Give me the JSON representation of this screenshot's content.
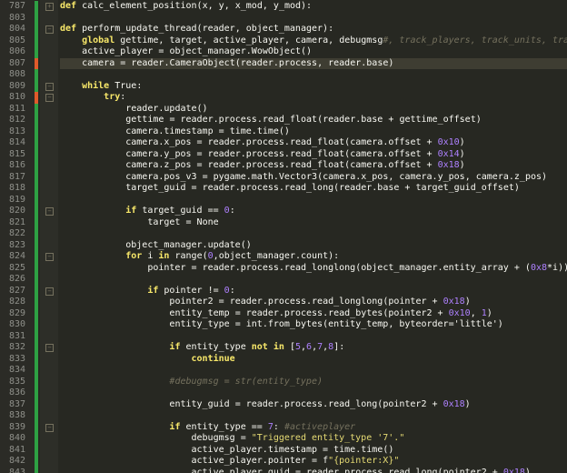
{
  "colors": {
    "background": "#272822",
    "diff_added": "#2ea043",
    "diff_modified": "#e05a2b",
    "keyword": "#f8e86a",
    "number": "#ae81ff",
    "string": "#e6db74",
    "comment": "#75715e"
  },
  "lines": [
    {
      "n": "787",
      "text": "def calc_element_position(x, y, x_mod, y_mod):",
      "fold": true
    },
    {
      "n": "803",
      "text": ""
    },
    {
      "n": "804",
      "text": "def perform_update_thread(reader, object_manager):",
      "fold": true
    },
    {
      "n": "805",
      "text": "    global gettime, target, active_player, camera, debugmsg#, track_players, track_units, track_o"
    },
    {
      "n": "806",
      "text": "    active_player = object_manager.WowObject()"
    },
    {
      "n": "807",
      "text": "    camera = reader.CameraObject(reader.process, reader.base)",
      "current": true
    },
    {
      "n": "808",
      "text": ""
    },
    {
      "n": "809",
      "text": "    while True:",
      "fold": true
    },
    {
      "n": "810",
      "text": "        try:",
      "fold": true
    },
    {
      "n": "811",
      "text": "            reader.update()"
    },
    {
      "n": "812",
      "text": "            gettime = reader.process.read_float(reader.base + gettime_offset)"
    },
    {
      "n": "813",
      "text": "            camera.timestamp = time.time()"
    },
    {
      "n": "814",
      "text": "            camera.x_pos = reader.process.read_float(camera.offset + 0x10)"
    },
    {
      "n": "815",
      "text": "            camera.y_pos = reader.process.read_float(camera.offset + 0x14)"
    },
    {
      "n": "816",
      "text": "            camera.z_pos = reader.process.read_float(camera.offset + 0x18)"
    },
    {
      "n": "817",
      "text": "            camera.pos_v3 = pygame.math.Vector3(camera.x_pos, camera.y_pos, camera.z_pos)"
    },
    {
      "n": "818",
      "text": "            target_guid = reader.process.read_long(reader.base + target_guid_offset)"
    },
    {
      "n": "819",
      "text": ""
    },
    {
      "n": "820",
      "text": "            if target_guid == 0:",
      "fold": true
    },
    {
      "n": "821",
      "text": "                target = None"
    },
    {
      "n": "822",
      "text": ""
    },
    {
      "n": "823",
      "text": "            object_manager.update()"
    },
    {
      "n": "824",
      "text": "            for i in range(0,object_manager.count):",
      "fold": true
    },
    {
      "n": "825",
      "text": "                pointer = reader.process.read_longlong(object_manager.entity_array + (0x8*i))"
    },
    {
      "n": "826",
      "text": ""
    },
    {
      "n": "827",
      "text": "                if pointer != 0:",
      "fold": true
    },
    {
      "n": "828",
      "text": "                    pointer2 = reader.process.read_longlong(pointer + 0x18)"
    },
    {
      "n": "829",
      "text": "                    entity_temp = reader.process.read_bytes(pointer2 + 0x10, 1)"
    },
    {
      "n": "830",
      "text": "                    entity_type = int.from_bytes(entity_temp, byteorder='little')"
    },
    {
      "n": "831",
      "text": ""
    },
    {
      "n": "832",
      "text": "                    if entity_type not in [5,6,7,8]:",
      "fold": true
    },
    {
      "n": "833",
      "text": "                        continue"
    },
    {
      "n": "834",
      "text": ""
    },
    {
      "n": "835",
      "text": "                    #debugmsg = str(entity_type)"
    },
    {
      "n": "836",
      "text": ""
    },
    {
      "n": "837",
      "text": "                    entity_guid = reader.process.read_long(pointer2 + 0x18)"
    },
    {
      "n": "838",
      "text": ""
    },
    {
      "n": "839",
      "text": "                    if entity_type == 7: #activeplayer",
      "fold": true
    },
    {
      "n": "840",
      "text": "                        debugmsg = \"Triggered entity_type '7'.\""
    },
    {
      "n": "841",
      "text": "                        active_player.timestamp = time.time()"
    },
    {
      "n": "842",
      "text": "                        active_player.pointer = f\"{pointer:X}\""
    },
    {
      "n": "843",
      "text": "                        active_player.guid = reader.process.read_long(pointer2 + 0x18)"
    }
  ]
}
